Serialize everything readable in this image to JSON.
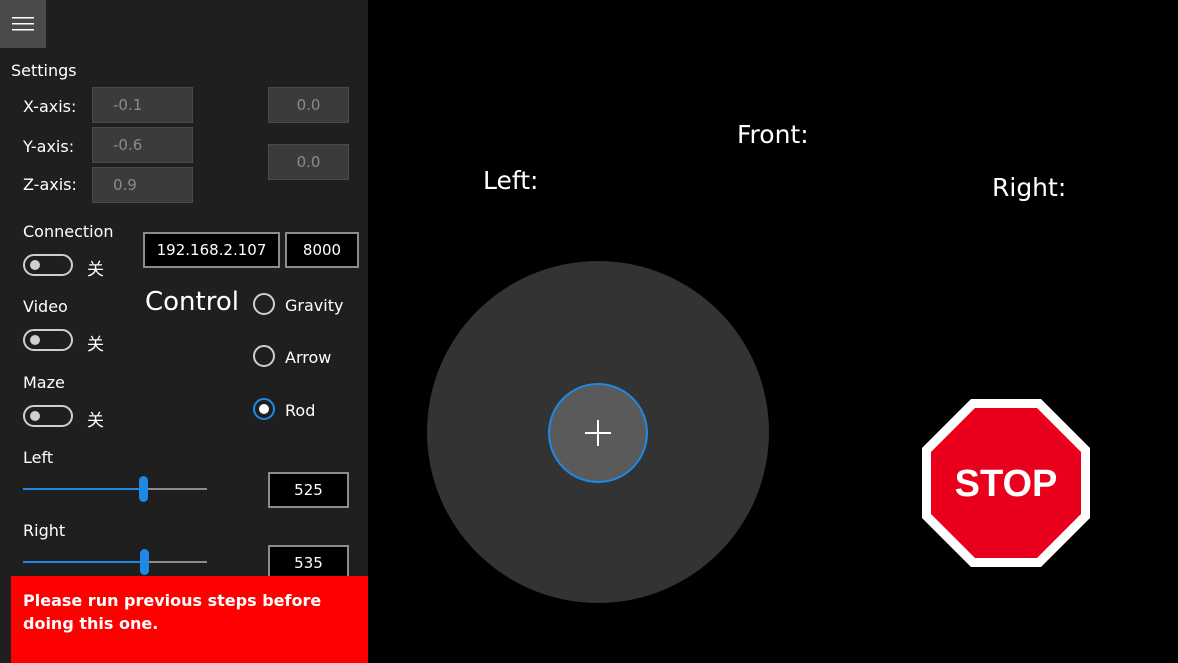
{
  "menu": {
    "icon": "hamburger-menu-icon"
  },
  "settings": {
    "title": "Settings",
    "x_label": "X-axis:",
    "y_label": "Y-axis:",
    "z_label": "Z-axis:",
    "x_value": "-0.1",
    "y_value": "-0.6",
    "z_value": "0.9",
    "offset_a": "0.0",
    "offset_b": "0.0"
  },
  "connection": {
    "label": "Connection",
    "ip": "192.168.2.107",
    "port": "8000",
    "state": "关",
    "on": false
  },
  "video": {
    "label": "Video",
    "state": "关",
    "on": false
  },
  "maze": {
    "label": "Maze",
    "state": "关",
    "on": false
  },
  "control": {
    "title": "Control",
    "options": [
      {
        "label": "Gravity",
        "checked": false
      },
      {
        "label": "Arrow",
        "checked": false
      },
      {
        "label": "Rod",
        "checked": true
      }
    ]
  },
  "left_motor": {
    "label": "Left",
    "value": "525",
    "slider_fraction": 0.65
  },
  "right_motor": {
    "label": "Right",
    "value": "535",
    "slider_fraction": 0.66
  },
  "error_message": "Please run previous steps before doing this one.",
  "sensors": {
    "front_label": "Front:",
    "left_label": "Left:",
    "right_label": "Right:"
  },
  "joystick": {
    "icon": "plus-icon"
  },
  "stop": {
    "label": "STOP",
    "color": "#e8001c"
  },
  "colors": {
    "accent": "#1e88e5",
    "error": "#ff0000",
    "panel": "#1f1f1f"
  }
}
